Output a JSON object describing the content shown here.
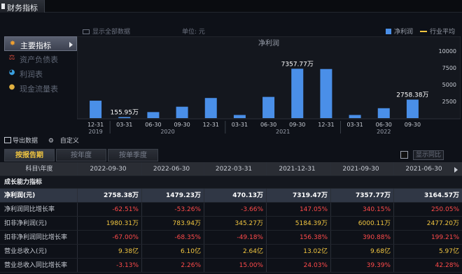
{
  "window": {
    "title": "财务指标"
  },
  "nav": [
    {
      "label": "主要指标",
      "icon": "star-icon",
      "active": true
    },
    {
      "label": "资产负债表",
      "icon": "balance-icon",
      "active": false
    },
    {
      "label": "利润表",
      "icon": "pie-icon",
      "active": false
    },
    {
      "label": "现金流量表",
      "icon": "coins-icon",
      "active": false
    }
  ],
  "chart_toolbar": {
    "show_all": "显示全部数据",
    "unit": "单位: 元",
    "legend_bar": "净利润",
    "legend_line": "行业平均"
  },
  "chart_data": {
    "type": "bar",
    "title": "净利润",
    "categories": [
      "2019-12-31",
      "2020-03-31",
      "2020-06-30",
      "2020-09-30",
      "2020-12-31",
      "2021-03-31",
      "2021-06-30",
      "2021-09-30",
      "2021-12-31",
      "2022-03-31",
      "2022-06-30",
      "2022-09-30"
    ],
    "tick_labels": [
      "12-31",
      "03-31",
      "06-30",
      "09-30",
      "12-31",
      "03-31",
      "06-30",
      "09-30",
      "12-31",
      "03-31",
      "06-30",
      "09-30"
    ],
    "year_labels": [
      {
        "label": "2019",
        "index": 0
      },
      {
        "label": "2020",
        "index": 2.5
      },
      {
        "label": "2021",
        "index": 6.5
      },
      {
        "label": "2022",
        "index": 10
      }
    ],
    "series": [
      {
        "name": "净利润",
        "unit": "万",
        "values": [
          2600,
          155.95,
          900,
          1700,
          3000,
          470.13,
          3164.57,
          7357.77,
          7319.47,
          470.13,
          1479.23,
          2758.38
        ]
      }
    ],
    "data_labels": [
      {
        "index": 1,
        "text": "155.95万"
      },
      {
        "index": 7,
        "text": "7357.77万"
      },
      {
        "index": 11,
        "text": "2758.38万"
      }
    ],
    "yticks": [
      2500,
      5000,
      7500,
      10000
    ],
    "ylim": [
      0,
      10000
    ],
    "colors": {
      "bar": "#4a8fe8",
      "line": "#f2c640"
    }
  },
  "tools": {
    "export": "导出数据",
    "customize": "自定义"
  },
  "tabs": [
    {
      "label": "按报告期",
      "active": true
    },
    {
      "label": "按年度",
      "active": false
    },
    {
      "label": "按单季度",
      "active": false
    }
  ],
  "yoy_button": "显示同比",
  "table": {
    "header_label": "科目\\年度",
    "columns": [
      "2022-09-30",
      "2022-06-30",
      "2022-03-31",
      "2021-12-31",
      "2021-09-30",
      "2021-06-30"
    ],
    "section": "成长能力指标",
    "rows": [
      {
        "label": "净利润(元)",
        "highlight": true,
        "color": "white",
        "values": [
          "2758.38万",
          "1479.23万",
          "470.13万",
          "7319.47万",
          "7357.77万",
          "3164.57万"
        ]
      },
      {
        "label": "净利润同比增长率",
        "color": "red",
        "values": [
          "-62.51%",
          "-53.26%",
          "-3.66%",
          "147.05%",
          "340.15%",
          "250.05%"
        ]
      },
      {
        "label": "扣非净利润(元)",
        "color": "yellow",
        "values": [
          "1980.31万",
          "783.94万",
          "345.27万",
          "5184.39万",
          "6000.11万",
          "2477.20万"
        ]
      },
      {
        "label": "扣非净利润同比增长率",
        "color": "red",
        "values": [
          "-67.00%",
          "-68.35%",
          "-49.18%",
          "156.38%",
          "390.88%",
          "199.21%"
        ]
      },
      {
        "label": "营业总收入(元)",
        "color": "yellow",
        "values": [
          "9.38亿",
          "6.10亿",
          "2.64亿",
          "13.02亿",
          "9.68亿",
          "5.97亿"
        ]
      },
      {
        "label": "营业总收入同比增长率",
        "color": "red",
        "values": [
          "-3.13%",
          "2.26%",
          "15.00%",
          "24.03%",
          "39.39%",
          "42.28%"
        ]
      }
    ]
  }
}
